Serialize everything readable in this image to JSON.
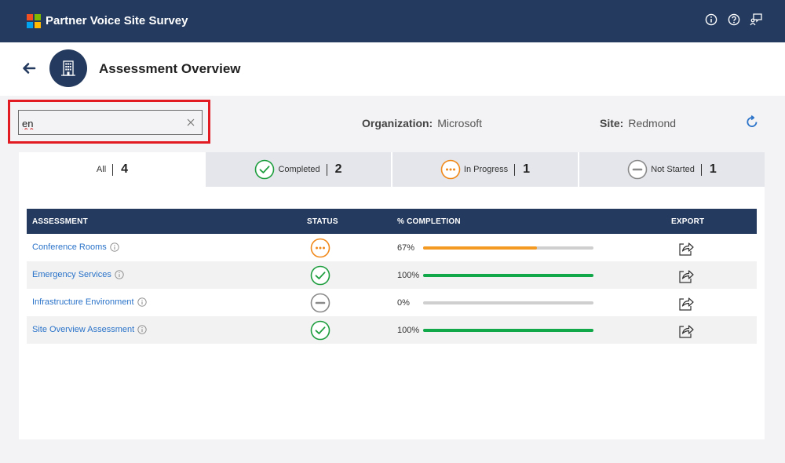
{
  "app": {
    "title": "Partner Voice Site Survey",
    "logo_colors": [
      "#f25022",
      "#7fba00",
      "#00a4ef",
      "#ffb900"
    ]
  },
  "topbar_icons": [
    "info-icon",
    "help-icon",
    "feedback-icon"
  ],
  "header": {
    "title": "Assessment Overview",
    "avatar_icon": "building-icon"
  },
  "search": {
    "value": "en",
    "placeholder": ""
  },
  "meta": {
    "organization_label": "Organization:",
    "organization_value": "Microsoft",
    "site_label": "Site:",
    "site_value": "Redmond"
  },
  "tabs": [
    {
      "label": "All",
      "count": "4",
      "icon": ""
    },
    {
      "label": "Completed",
      "count": "2",
      "icon": "check-circle-icon"
    },
    {
      "label": "In Progress",
      "count": "1",
      "icon": "ellipsis-circle-icon"
    },
    {
      "label": "Not Started",
      "count": "1",
      "icon": "minus-circle-icon"
    }
  ],
  "table": {
    "headers": {
      "assessment": "ASSESSMENT",
      "status": "STATUS",
      "completion": "% COMPLETION",
      "export": "EXPORT"
    },
    "rows": [
      {
        "name": "Conference Rooms",
        "status": "in-progress",
        "pct_label": "67%",
        "pct": 67
      },
      {
        "name": "Emergency Services",
        "status": "completed",
        "pct_label": "100%",
        "pct": 100
      },
      {
        "name": "Infrastructure Environment",
        "status": "not-started",
        "pct_label": "0%",
        "pct": 0
      },
      {
        "name": "Site Overview Assessment",
        "status": "completed",
        "pct_label": "100%",
        "pct": 100
      }
    ]
  },
  "colors": {
    "navy": "#243a5e",
    "completed": "#1e9e3e",
    "in_progress": "#f0891a",
    "not_started": "#8a8a8a",
    "link": "#2a73c9",
    "bar_complete": "#11a84a",
    "bar_progress": "#f49a22",
    "highlight": "#e21b23"
  }
}
